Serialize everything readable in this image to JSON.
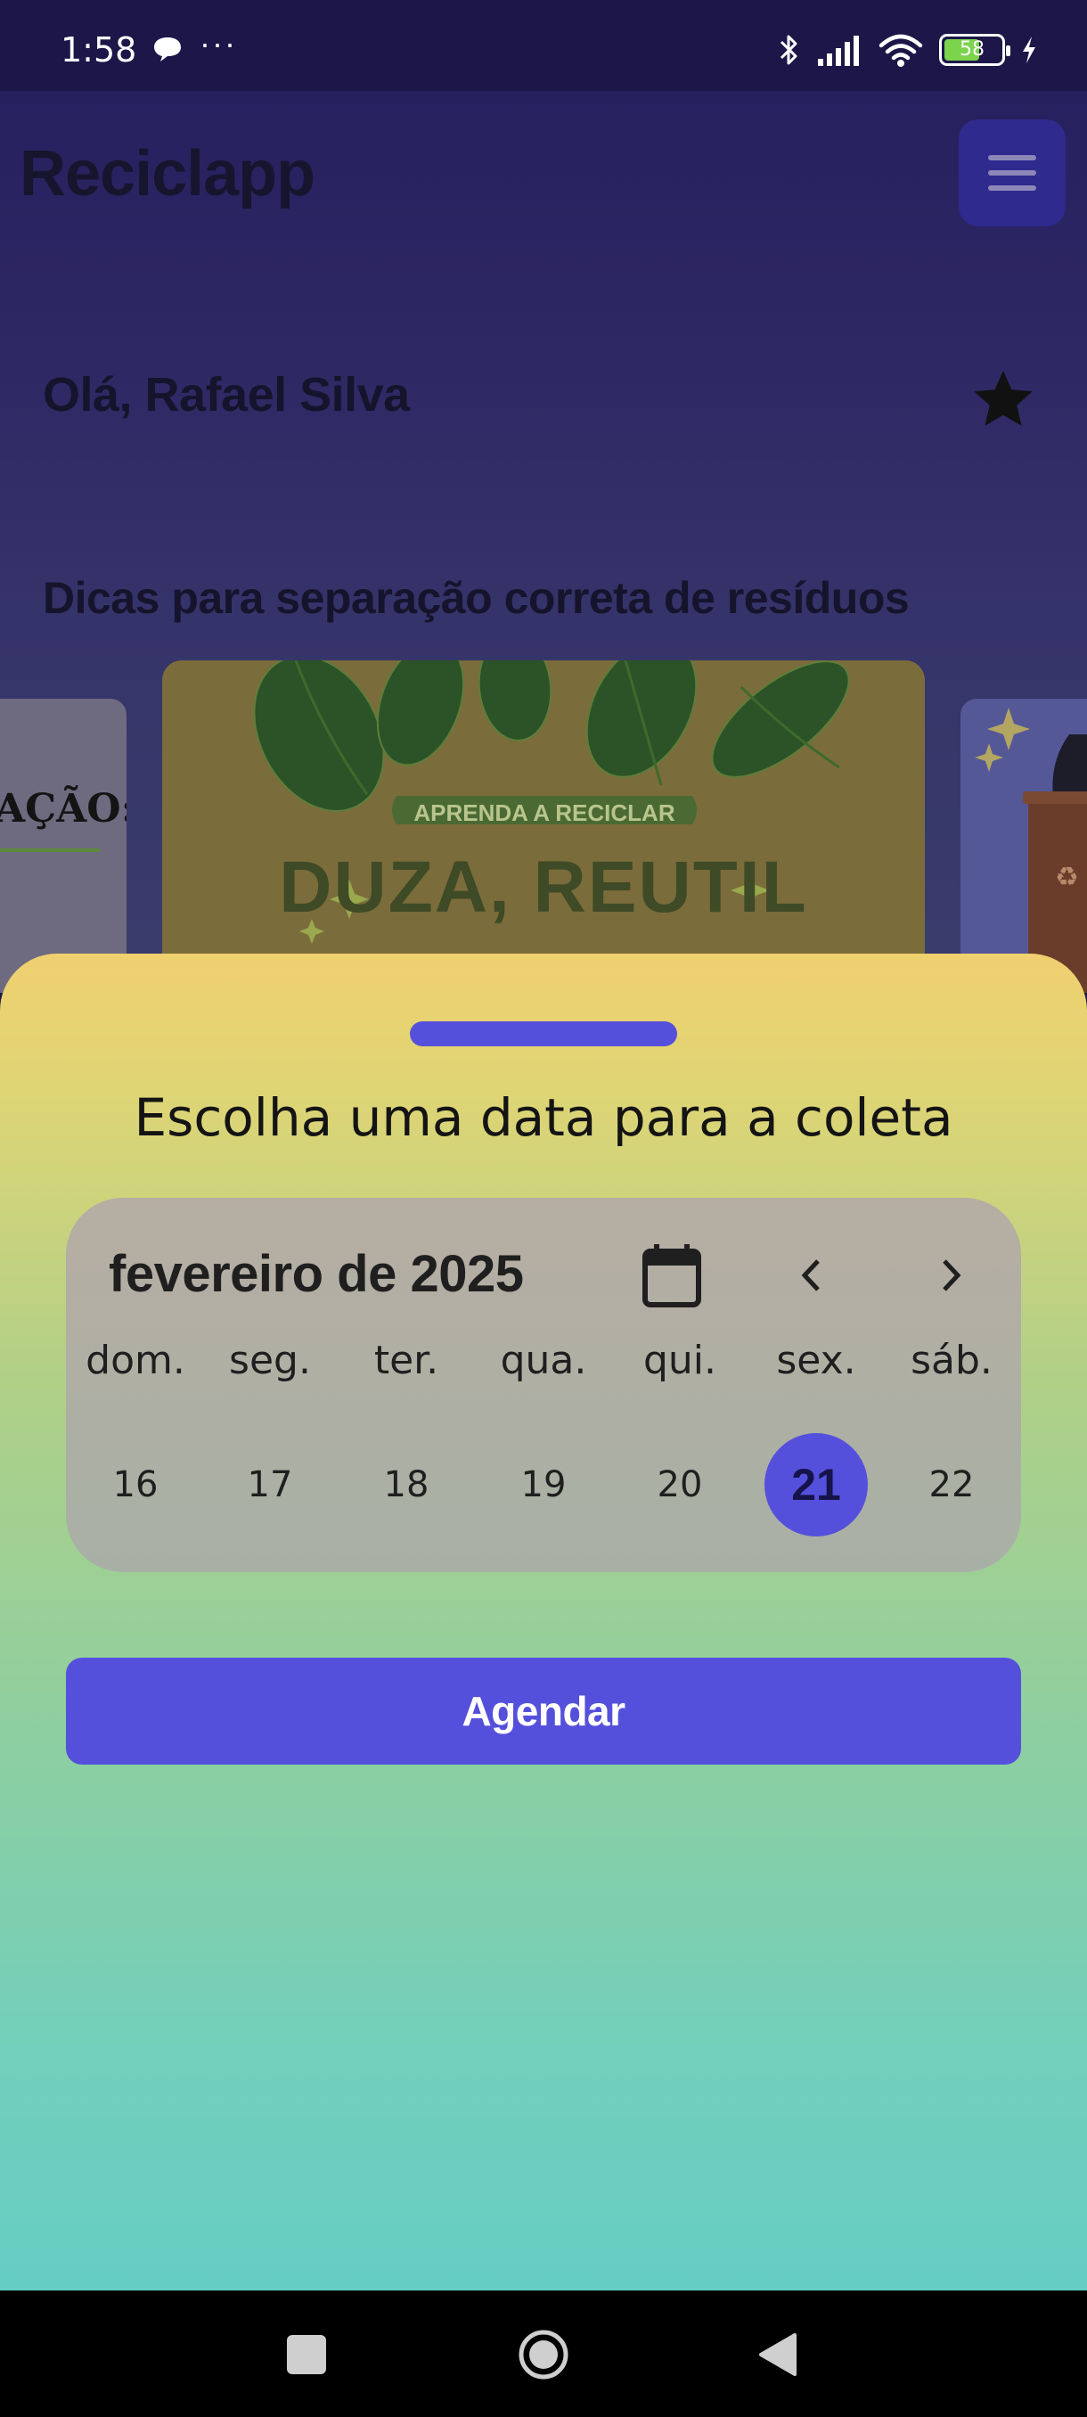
{
  "status_bar": {
    "time": "1:58",
    "more_label": "···",
    "battery_level": "58",
    "icons": [
      "chat-bubble-icon",
      "bluetooth-icon",
      "signal-icon",
      "wifi-icon",
      "battery-icon",
      "charging-icon"
    ]
  },
  "app": {
    "title": "Reciclapp",
    "menu_icon": "hamburger-menu-icon",
    "greeting": "Olá, Rafael Silva",
    "favorite_icon": "star-icon",
    "tips_title": "Dicas para separação correta de resíduos",
    "carousel": {
      "left_card_partial_text": "AÇÃO:",
      "main_card_badge": "APRENDA A RECICLAR",
      "main_card_partial_text": "DUZA, REUTIL"
    }
  },
  "sheet": {
    "title": "Escolha uma data para a coleta",
    "calendar": {
      "month_label": "fevereiro de 2025",
      "weekdays": [
        "dom.",
        "seg.",
        "ter.",
        "qua.",
        "qui.",
        "sex.",
        "sáb."
      ],
      "days": [
        "16",
        "17",
        "18",
        "19",
        "20",
        "21",
        "22"
      ],
      "selected_day": "21",
      "prev_icon": "chevron-left-icon",
      "next_icon": "chevron-right-icon",
      "calendar_icon": "calendar-icon"
    },
    "schedule_button": "Agendar"
  },
  "colors": {
    "primary": "#5550db",
    "header_bg": "#1c1748",
    "sheet_top": "#f0d06f",
    "sheet_bottom": "#66cdc4"
  }
}
